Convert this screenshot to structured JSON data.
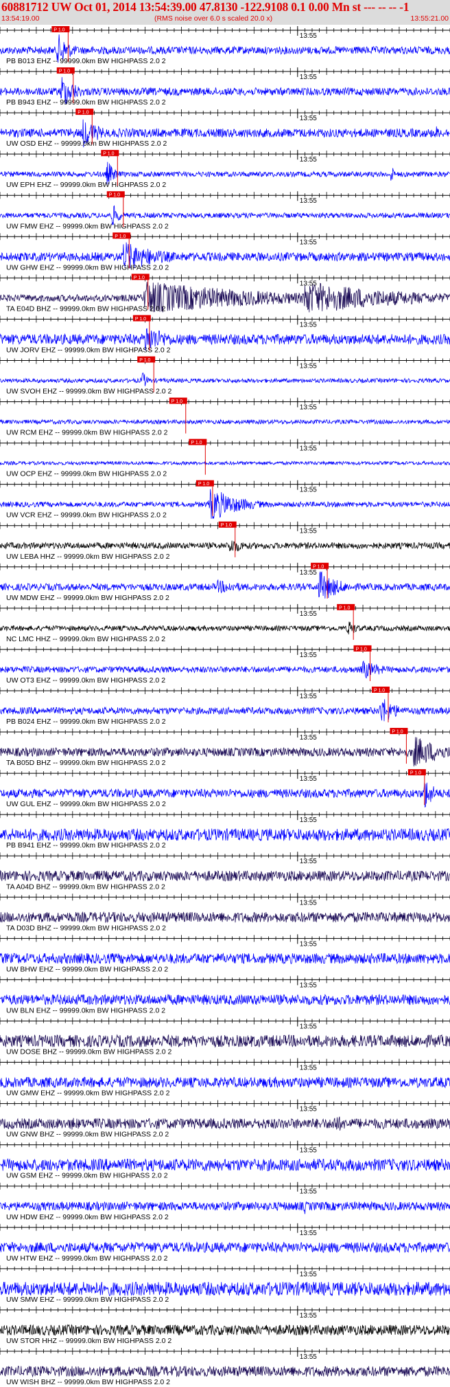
{
  "header": {
    "title": "60881712 UW Oct 01, 2014 13:54:39.00   47.8130 -122.9108  0.1 0.00 Mn st --- -- --  -1",
    "start_time": "13:54:19.00",
    "note": "(RMS noise over 6.0 s scaled 20.0 x)",
    "end_time": "13:55:21.00"
  },
  "chart_data": {
    "type": "line",
    "title": "60881712 UW Oct 01, 2014 13:54:39.00   47.8130 -122.9108  0.1 0.00 Mn st --- -- --  -1",
    "x_range_seconds": [
      0,
      62
    ],
    "minute_mark_label": "13:55",
    "minute_mark_at": 41,
    "tick_interval_seconds": 1,
    "pick_label": "P 1.0",
    "traces": [
      {
        "label": "PB B013 EHZ -- 99999.0km BW  HIGHPASS  2.0  2",
        "color": "#0000ff",
        "pick": 7.5,
        "noise": 0.22,
        "bursts": [
          [
            8,
            1.0,
            2.5
          ]
        ]
      },
      {
        "label": "PB B943 EHZ -- 99999.0km BW  HIGHPASS  2.0  2",
        "color": "#0000ff",
        "pick": 8.2,
        "noise": 0.22,
        "bursts": [
          [
            8.5,
            1.0,
            3
          ]
        ]
      },
      {
        "label": "UW OSD EHZ -- 99999.0km BW  HIGHPASS  2.0  2",
        "color": "#0000ff",
        "pick": 10.8,
        "noise": 0.25,
        "bursts": [
          [
            11.5,
            1.0,
            3
          ],
          [
            60,
            0.5,
            1
          ]
        ]
      },
      {
        "label": "UW EPH EHZ -- 99999.0km BW  HIGHPASS  2.0  2",
        "color": "#0000ff",
        "pick": 14.3,
        "noise": 0.15,
        "bursts": [
          [
            14.8,
            0.8,
            1.5
          ],
          [
            54,
            0.9,
            0.3
          ]
        ]
      },
      {
        "label": "UW FMW EHZ -- 99999.0km BW  HIGHPASS  2.0  2",
        "color": "#0000ff",
        "pick": 15.1,
        "noise": 0.15,
        "bursts": [
          [
            15.5,
            0.7,
            1.5
          ],
          [
            31,
            0.2,
            1
          ]
        ]
      },
      {
        "label": "UW GHW EHZ -- 99999.0km BW  HIGHPASS  2.0  2",
        "color": "#0000ff",
        "pick": 15.9,
        "noise": 0.25,
        "bursts": [
          [
            17,
            0.9,
            8
          ]
        ]
      },
      {
        "label": "TA E04D BHZ -- 99999.0km BW  HIGHPASS  2.0  2",
        "color": "#1a0a55",
        "pick": 18.5,
        "noise": 0.2,
        "bursts": [
          [
            20,
            1.0,
            25
          ],
          [
            42,
            1.0,
            20
          ]
        ]
      },
      {
        "label": "UW JORV EHZ -- 99999.0km BW  HIGHPASS  2.0  2",
        "color": "#0000ff",
        "pick": 18.7,
        "noise": 0.3,
        "bursts": [
          [
            20,
            0.9,
            5
          ]
        ]
      },
      {
        "label": "UW SVOH EHZ -- 99999.0km BW  HIGHPASS  2.0  2",
        "color": "#0000ff",
        "pick": 19.3,
        "noise": 0.12,
        "bursts": [
          [
            19.6,
            0.6,
            1
          ]
        ]
      },
      {
        "label": "UW RCM EHZ -- 99999.0km BW  HIGHPASS  2.0  2",
        "color": "#0000ff",
        "pick": 23.7,
        "noise": 0.12,
        "bursts": []
      },
      {
        "label": "UW OCP EHZ -- 99999.0km BW  HIGHPASS  2.0  2",
        "color": "#0000ff",
        "pick": 26.4,
        "noise": 0.1,
        "bursts": []
      },
      {
        "label": "UW VCR EHZ -- 99999.0km BW  HIGHPASS  2.0  2",
        "color": "#0000ff",
        "pick": 27.4,
        "noise": 0.15,
        "bursts": [
          [
            29,
            1.0,
            6
          ]
        ]
      },
      {
        "label": "UW LEBA HHZ -- 99999.0km BW  HIGHPASS  2.0  2",
        "color": "#000000",
        "pick": 30.5,
        "noise": 0.18,
        "bursts": [
          [
            31.5,
            0.5,
            4
          ]
        ]
      },
      {
        "label": "UW MDW EHZ -- 99999.0km BW  HIGHPASS  2.0  2",
        "color": "#0000ff",
        "pick": 43.2,
        "noise": 0.2,
        "bursts": [
          [
            44,
            1.0,
            4
          ],
          [
            30,
            0.4,
            8
          ]
        ]
      },
      {
        "label": "NC LMC HHZ -- 99999.0km BW  HIGHPASS  2.0  2",
        "color": "#000000",
        "pick": 46.8,
        "noise": 0.15,
        "bursts": [
          [
            48,
            0.5,
            2
          ]
        ]
      },
      {
        "label": "UW OT3 EHZ -- 99999.0km BW  HIGHPASS  2.0  2",
        "color": "#0000ff",
        "pick": 49.1,
        "noise": 0.18,
        "bursts": [
          [
            50,
            0.6,
            4
          ]
        ]
      },
      {
        "label": "PB B024 EHZ -- 99999.0km BW  HIGHPASS  2.0  2",
        "color": "#0000ff",
        "pick": 51.6,
        "noise": 0.2,
        "bursts": [
          [
            52.5,
            0.9,
            3
          ]
        ]
      },
      {
        "label": "TA B05D BHZ -- 99999.0km BW  HIGHPASS  2.0  2",
        "color": "#1a0a55",
        "pick": 54.1,
        "noise": 0.25,
        "bursts": [
          [
            57,
            1.0,
            6
          ]
        ]
      },
      {
        "label": "UW GUL EHZ -- 99999.0km BW  HIGHPASS  2.0  2",
        "color": "#0000ff",
        "pick": 56.6,
        "noise": 0.25,
        "bursts": [
          [
            58.5,
            1.0,
            2
          ]
        ]
      },
      {
        "label": "PB B941 EHZ -- 99999.0km BW  HIGHPASS  2.0  2",
        "color": "#0000ff",
        "noise": 0.35,
        "bursts": []
      },
      {
        "label": "TA A04D BHZ -- 99999.0km BW  HIGHPASS  2.0  2",
        "color": "#1a0a55",
        "noise": 0.3,
        "bursts": []
      },
      {
        "label": "TA D03D BHZ -- 99999.0km BW  HIGHPASS  2.0  2",
        "color": "#1a0a55",
        "noise": 0.3,
        "bursts": []
      },
      {
        "label": "UW BHW EHZ -- 99999.0km BW  HIGHPASS  2.0  2",
        "color": "#0000ff",
        "noise": 0.3,
        "bursts": []
      },
      {
        "label": "UW BLN EHZ -- 99999.0km BW  HIGHPASS  2.0  2",
        "color": "#0000ff",
        "noise": 0.3,
        "bursts": []
      },
      {
        "label": "UW DOSE BHZ -- 99999.0km BW  HIGHPASS  2.0  2",
        "color": "#1a0a55",
        "noise": 0.35,
        "bursts": []
      },
      {
        "label": "UW GMW EHZ -- 99999.0km BW  HIGHPASS  2.0  2",
        "color": "#0000ff",
        "noise": 0.3,
        "bursts": []
      },
      {
        "label": "UW GNW BHZ -- 99999.0km BW  HIGHPASS  2.0  2",
        "color": "#1a0a55",
        "noise": 0.3,
        "bursts": [
          [
            10,
            0.5,
            1
          ],
          [
            46,
            0.6,
            3
          ]
        ]
      },
      {
        "label": "UW GSM EHZ -- 99999.0km BW  HIGHPASS  2.0  2",
        "color": "#0000ff",
        "noise": 0.35,
        "bursts": []
      },
      {
        "label": "UW HDW EHZ -- 99999.0km BW  HIGHPASS  2.0  2",
        "color": "#0000ff",
        "noise": 0.25,
        "bursts": [
          [
            42,
            0.5,
            0.3
          ]
        ]
      },
      {
        "label": "UW HTW EHZ -- 99999.0km BW  HIGHPASS  2.0  2",
        "color": "#0000ff",
        "noise": 0.3,
        "bursts": []
      },
      {
        "label": "UW SMW EHZ -- 99999.0km BW  HIGHPASS  2.0  2",
        "color": "#0000ff",
        "noise": 0.4,
        "bursts": []
      },
      {
        "label": "UW STOR HHZ -- 99999.0km BW  HIGHPASS  2.0  2",
        "color": "#000000",
        "noise": 0.3,
        "bursts": []
      },
      {
        "label": "UW WISH BHZ -- 99999.0km BW  HIGHPASS  2.0  2",
        "color": "#1a0a55",
        "noise": 0.3,
        "bursts": []
      }
    ]
  }
}
